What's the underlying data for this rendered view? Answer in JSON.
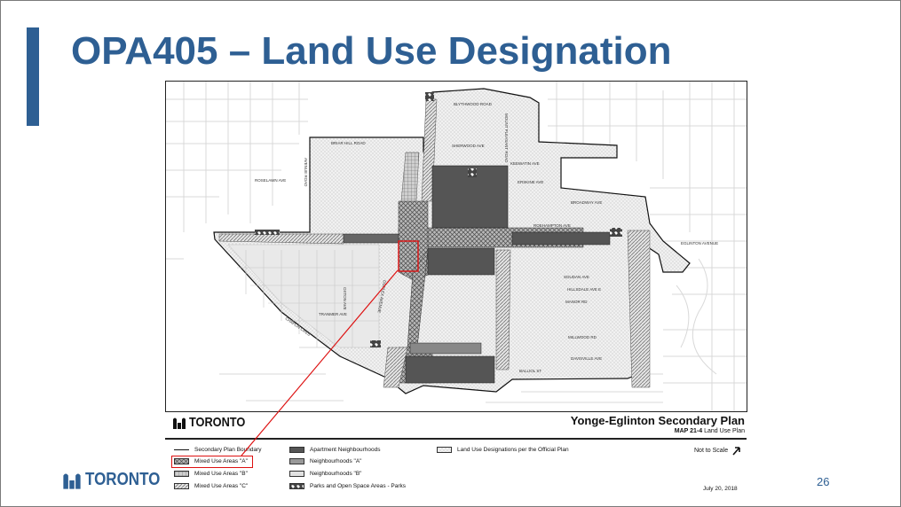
{
  "slide": {
    "title": "OPA405 – Land Use Designation",
    "page_number": "26",
    "accent_color": "#2e5f93",
    "highlight_color": "#dd1111"
  },
  "map": {
    "plan_title": "Yonge-Eglinton Secondary Plan",
    "plan_subtitle_bold": "MAP 21-4",
    "plan_subtitle": "Land Use Plan",
    "logo_text": "TORONTO",
    "not_to_scale": "Not to Scale",
    "date": "July 20, 2018",
    "streets": [
      {
        "name": "BLYTHWOOD ROAD"
      },
      {
        "name": "BRIAR HILL ROAD"
      },
      {
        "name": "SHERWOOD AVE"
      },
      {
        "name": "KEEWATIN AVE"
      },
      {
        "name": "ROSELAWN AVE"
      },
      {
        "name": "ERSKINE AVE"
      },
      {
        "name": "BROADWAY AVE"
      },
      {
        "name": "ROEHAMPTON AVE"
      },
      {
        "name": "EGLINTON AVENUE"
      },
      {
        "name": "SOUDAN AVE"
      },
      {
        "name": "HILLSDALE AVE E"
      },
      {
        "name": "MANOR RD"
      },
      {
        "name": "TRANMER AVE"
      },
      {
        "name": "CHAPLIN CRES"
      },
      {
        "name": "MILLWOOD RD"
      },
      {
        "name": "DAVISVILLE AVE"
      },
      {
        "name": "BALLIOL ST"
      },
      {
        "name": "AVENUE ROAD"
      },
      {
        "name": "MOUNT PLEASANT ROAD"
      },
      {
        "name": "OXTON AVE"
      },
      {
        "name": "DUPLEX AVENUE"
      }
    ],
    "legend": [
      {
        "label": "Secondary Plan Boundary",
        "pattern": "line"
      },
      {
        "label": "Mixed Use Areas \"A\"",
        "pattern": "crosshatch"
      },
      {
        "label": "Mixed Use Areas \"B\"",
        "pattern": "grid"
      },
      {
        "label": "Mixed Use Areas \"C\"",
        "pattern": "diagonal"
      },
      {
        "label": "Apartment Neighbourhoods",
        "pattern": "dark"
      },
      {
        "label": "Neighbourhoods \"A\"",
        "pattern": "mid"
      },
      {
        "label": "Neighbourhoods \"B\"",
        "pattern": "light"
      },
      {
        "label": "Parks and Open Space Areas - Parks",
        "pattern": "parks"
      },
      {
        "label": "Land Use Designations per the Official Plan",
        "pattern": "dots"
      }
    ]
  },
  "footer": {
    "logo_text": "TORONTO"
  }
}
